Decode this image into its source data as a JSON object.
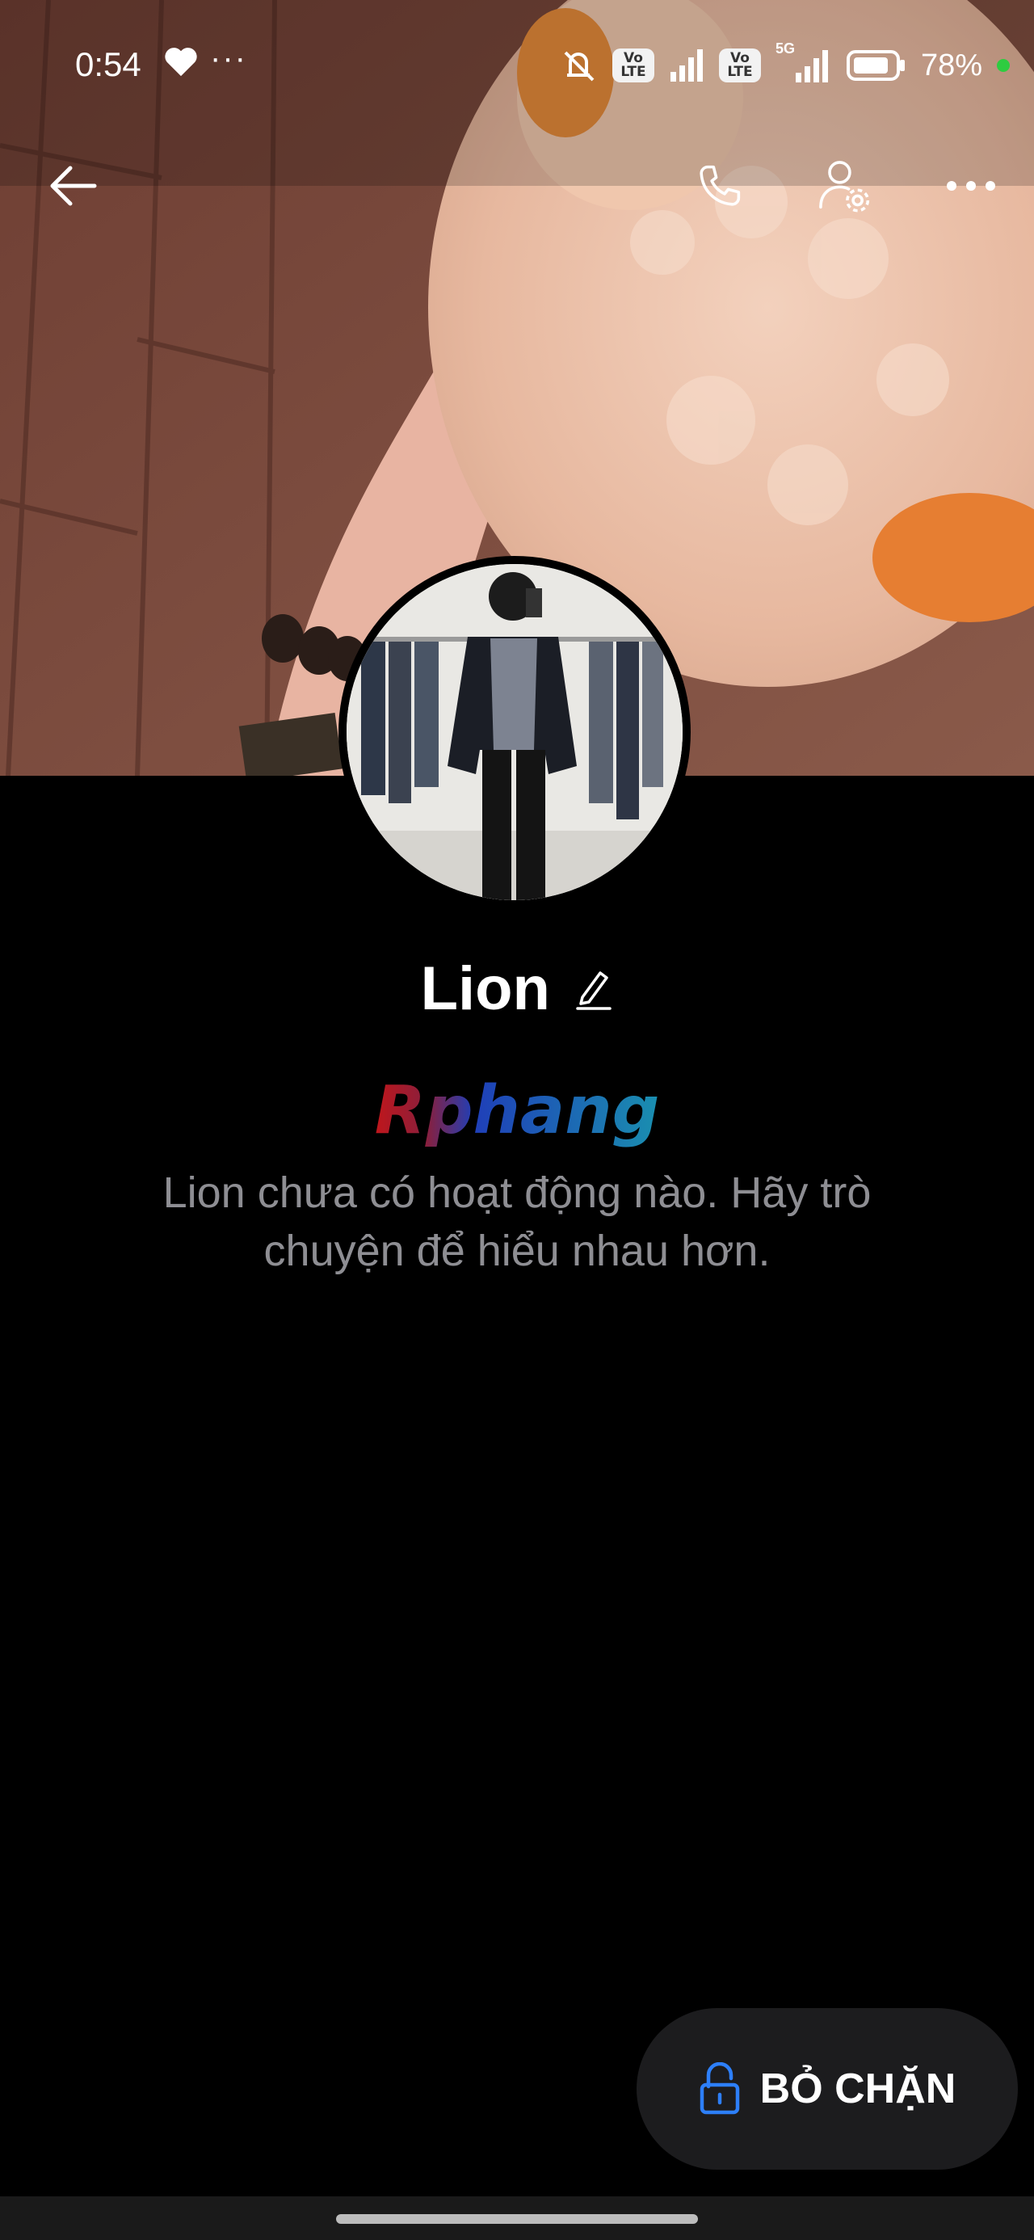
{
  "status_bar": {
    "time": "0:54",
    "heart_icon": "heart-icon",
    "more_dots": "···",
    "volte_1": "Vo LTE",
    "volte_2": "Vo LTE",
    "network_5g": "5G",
    "battery_percent": "78%"
  },
  "header": {
    "back_icon": "arrow-left-icon",
    "call_icon": "phone-icon",
    "settings_icon": "user-settings-icon",
    "more_icon": "more-horizontal-icon"
  },
  "profile": {
    "name": "Lion",
    "edit_icon": "pencil-icon",
    "watermark": "Rphang",
    "empty_message": "Lion chưa có hoạt động nào. Hãy trò chuyện để hiểu nhau hơn."
  },
  "actions": {
    "unblock_label": "BỎ CHẶN",
    "unblock_icon": "unlock-icon",
    "accent": "#2d7ff9"
  }
}
